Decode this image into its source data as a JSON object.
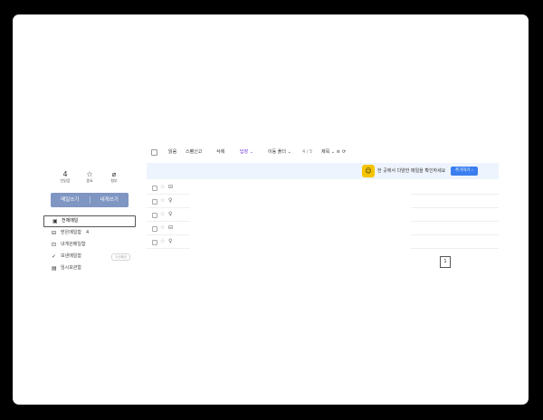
{
  "quick_actions": [
    {
      "label": "안읽음",
      "icon": "unread-count-icon",
      "glyph": "4"
    },
    {
      "label": "중요",
      "icon": "star-outline-icon",
      "glyph": "☆"
    },
    {
      "label": "첨부",
      "icon": "paperclip-icon",
      "glyph": "⌀"
    }
  ],
  "compose": {
    "write_label": "메일쓰기",
    "self_label": "내게쓰기"
  },
  "folders": [
    {
      "name": "전체메일",
      "icon": "▣",
      "count": "",
      "badge": ""
    },
    {
      "name": "받은메일함",
      "icon": "⊟",
      "count": "4",
      "badge": ""
    },
    {
      "name": "내게쓴메일함",
      "icon": "⊡",
      "count": "",
      "badge": ""
    },
    {
      "name": "보낸메일함",
      "icon": "✓",
      "count": "",
      "badge": "수신확인"
    },
    {
      "name": "임시보관함",
      "icon": "▤",
      "count": "",
      "badge": ""
    }
  ],
  "toolbar": {
    "read": "읽음",
    "spam": "스팸신고",
    "delete": "삭제",
    "reply": "답장 ⌄",
    "move": "이동 폴더 ⌄",
    "count": "4 / 5",
    "more": "제목 ⌄ ≡",
    "refresh": "⟳"
  },
  "promo": {
    "icon_glyph": "☺",
    "text": "한 곳에서 다양한 메일을 확인하세요",
    "button": "추가하기 ›"
  },
  "mail_rows": [
    {
      "type_icon": "⊟"
    },
    {
      "type_icon": "♀"
    },
    {
      "type_icon": "♀"
    },
    {
      "type_icon": "⊟"
    },
    {
      "type_icon": "♀"
    }
  ],
  "pagination": {
    "current": "1"
  },
  "colors": {
    "compose_bg": "#7f95c2",
    "promo_bg": "#eef4fd",
    "promo_icon": "#f5c400",
    "promo_button": "#3b7ef0",
    "reply_accent": "#6a36d9"
  }
}
